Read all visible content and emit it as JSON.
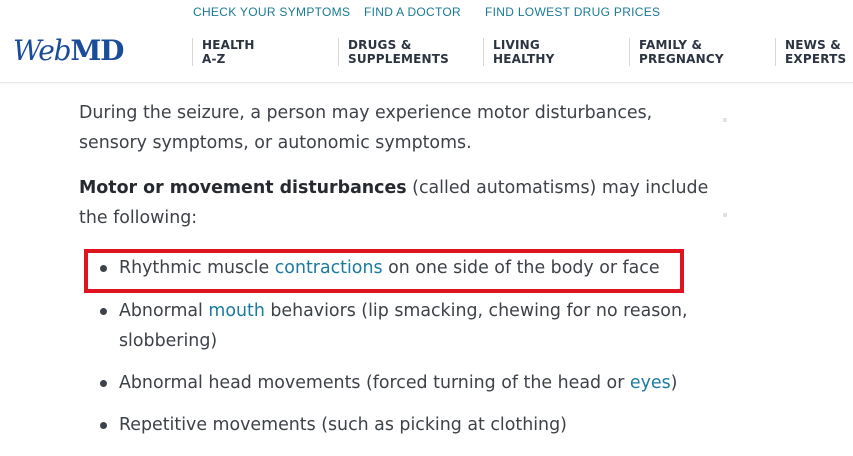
{
  "header": {
    "top_links": [
      "CHECK YOUR SYMPTOMS",
      "FIND A DOCTOR",
      "FIND LOWEST DRUG PRICES"
    ],
    "logo": {
      "web": "Web",
      "md": "MD"
    },
    "nav": [
      "HEALTH\nA-Z",
      "DRUGS &\nSUPPLEMENTS",
      "LIVING\nHEALTHY",
      "FAMILY &\nPREGNANCY",
      "NEWS &\nEXPERTS"
    ]
  },
  "article": {
    "para1": "During the seizure, a person may experience motor disturbances, sensory symptoms, or autonomic symptoms.",
    "para2_bold": "Motor or movement disturbances",
    "para2_rest": " (called automatisms) may include the following:",
    "bullets": [
      {
        "pre": "Rhythmic muscle ",
        "link": "contractions",
        "post": " on one side of the body or face",
        "highlighted": true
      },
      {
        "pre": "Abnormal ",
        "link": "mouth",
        "post": " behaviors (lip smacking, chewing for no reason, slobbering)"
      },
      {
        "pre": "Abnormal head movements (forced turning of the head or ",
        "link": "eyes",
        "post": ")"
      },
      {
        "pre": "Repetitive movements (such as picking at clothing)",
        "link": "",
        "post": ""
      }
    ]
  },
  "colors": {
    "link": "#1a7aa0",
    "logo": "#1a4c9c",
    "highlight_border": "#e0141e",
    "body_text": "#3d4148"
  }
}
